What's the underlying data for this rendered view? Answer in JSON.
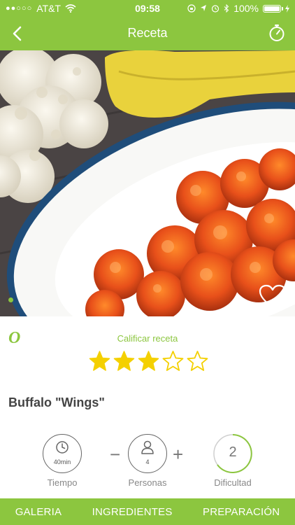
{
  "status": {
    "carrier": "AT&T",
    "time": "09:58",
    "battery": "100%"
  },
  "nav": {
    "title": "Receta"
  },
  "rating": {
    "label": "Calificar receta",
    "value": 3,
    "max": 5
  },
  "brand": {
    "logo_text": "O"
  },
  "recipe": {
    "title": "Buffalo \"Wings\""
  },
  "info": {
    "time_value": "40min",
    "time_label": "Tiempo",
    "persons_value": "4",
    "persons_label": "Personas",
    "difficulty_value": "2",
    "difficulty_label": "Dificultad",
    "minus": "−",
    "plus": "+"
  },
  "tabs": [
    "GALERIA",
    "INGREDIENTES",
    "PREPARACIÓN"
  ],
  "colors": {
    "accent": "#8cc63f",
    "star": "#f4d000"
  }
}
